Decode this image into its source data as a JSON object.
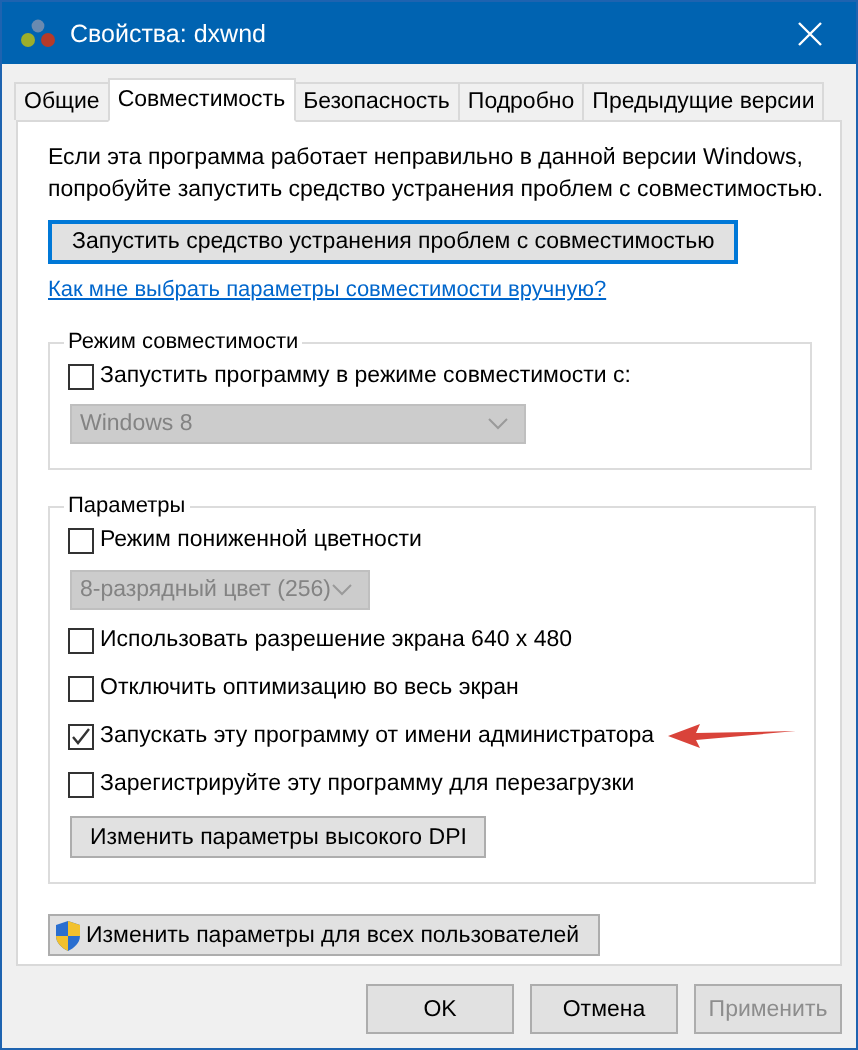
{
  "window": {
    "title": "Свойства: dxwnd"
  },
  "tabs": [
    {
      "label": "Общие",
      "selected": false
    },
    {
      "label": "Совместимость",
      "selected": true
    },
    {
      "label": "Безопасность",
      "selected": false
    },
    {
      "label": "Подробно",
      "selected": false
    },
    {
      "label": "Предыдущие версии",
      "selected": false
    }
  ],
  "intro_text": "Если эта программа работает неправильно в данной версии Windows, попробуйте запустить средство устранения проблем с совместимостью.",
  "troubleshoot_button": {
    "label": "Запустить средство устранения проблем с совместимостью",
    "focused": true
  },
  "help_link": "Как мне выбрать параметры совместимости вручную?",
  "compat_group": {
    "title": "Режим совместимости",
    "checkbox": {
      "label": "Запустить программу в режиме совместимости с:",
      "checked": false
    },
    "dropdown": {
      "value": "Windows 8",
      "disabled": true
    }
  },
  "params_group": {
    "title": "Параметры",
    "options": [
      {
        "kind": "checkbox",
        "label": "Режим пониженной цветности",
        "checked": false
      },
      {
        "kind": "dropdown",
        "value": "8-разрядный цвет (256)",
        "disabled": true
      },
      {
        "kind": "checkbox",
        "label": "Использовать разрешение экрана 640 x 480",
        "checked": false
      },
      {
        "kind": "checkbox",
        "label": "Отключить оптимизацию во весь экран",
        "checked": false
      },
      {
        "kind": "checkbox",
        "label": "Запускать эту программу от имени администратора",
        "checked": true,
        "annotated": true
      },
      {
        "kind": "checkbox",
        "label": "Зарегистрируйте эту программу для перезагрузки",
        "checked": false
      }
    ],
    "dpi_button": "Изменить параметры высокого DPI"
  },
  "all_users_button": "Изменить параметры для всех пользователей",
  "buttons": [
    {
      "label": "OK",
      "disabled": false
    },
    {
      "label": "Отмена",
      "disabled": false
    },
    {
      "label": "Применить",
      "disabled": true
    }
  ]
}
